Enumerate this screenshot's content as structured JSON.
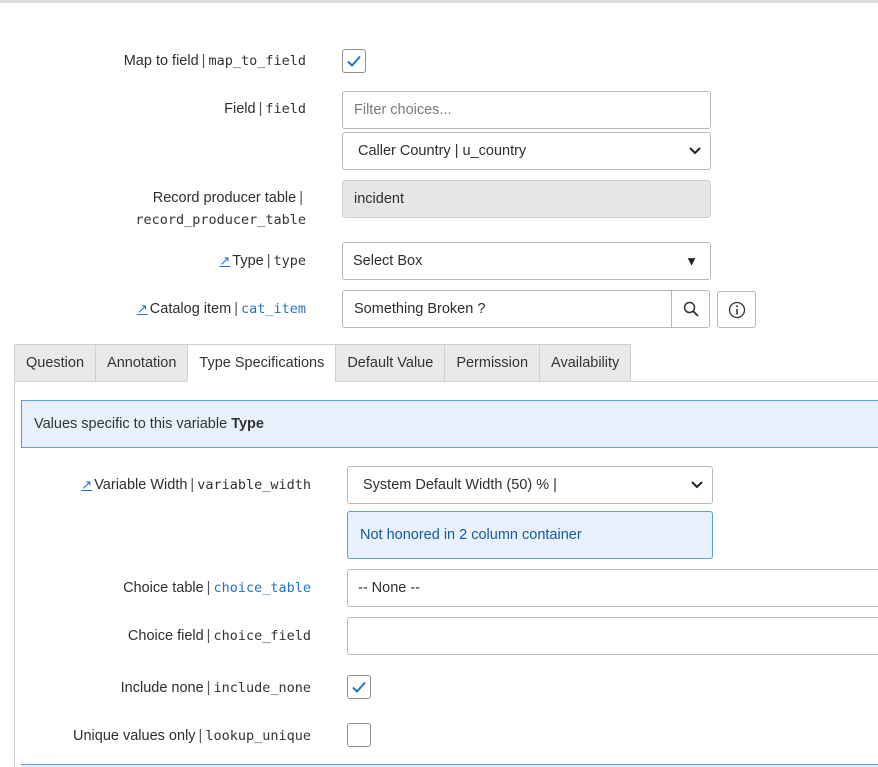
{
  "form": {
    "map_to_field": {
      "label": "Map to field",
      "name": "map_to_field",
      "checked": true
    },
    "field": {
      "label": "Field",
      "name": "field",
      "filter_placeholder": "Filter choices...",
      "selected": "Caller Country | u_country"
    },
    "record_producer_table": {
      "label": "Record producer table",
      "name": "record_producer_table",
      "value": "incident"
    },
    "type": {
      "label": "Type",
      "name": "type",
      "value": "Select Box"
    },
    "catalog_item": {
      "label": "Catalog item",
      "name": "cat_item",
      "value": "Something Broken ?"
    }
  },
  "tabs": [
    {
      "label": "Question",
      "active": false
    },
    {
      "label": "Annotation",
      "active": false
    },
    {
      "label": "Type Specifications",
      "active": true
    },
    {
      "label": "Default Value",
      "active": false
    },
    {
      "label": "Permission",
      "active": false
    },
    {
      "label": "Availability",
      "active": false
    }
  ],
  "type_spec": {
    "banner_text": "Values specific to this variable",
    "banner_bold": "Type",
    "variable_width": {
      "label": "Variable Width",
      "name": "variable_width",
      "value": "System Default Width (50) % |"
    },
    "width_note": "Not honored in 2 column container",
    "choice_table": {
      "label": "Choice table",
      "name": "choice_table",
      "value": "-- None --"
    },
    "choice_field": {
      "label": "Choice field",
      "name": "choice_field",
      "value": ""
    },
    "include_none": {
      "label": "Include none",
      "name": "include_none",
      "checked": true
    },
    "unique_values": {
      "label": "Unique values only",
      "name": "lookup_unique",
      "checked": false
    }
  },
  "icons": {
    "reference": "reference-link-icon",
    "search": "magnifier-icon",
    "info": "info-circle-icon",
    "chevron": "chevron-down-icon",
    "triangle": "triangle-down-icon",
    "check": "checkmark-icon"
  },
  "colors": {
    "accent": "#1f74c4",
    "info_bg": "#e8f1fb",
    "info_border": "#5ba2dc"
  }
}
